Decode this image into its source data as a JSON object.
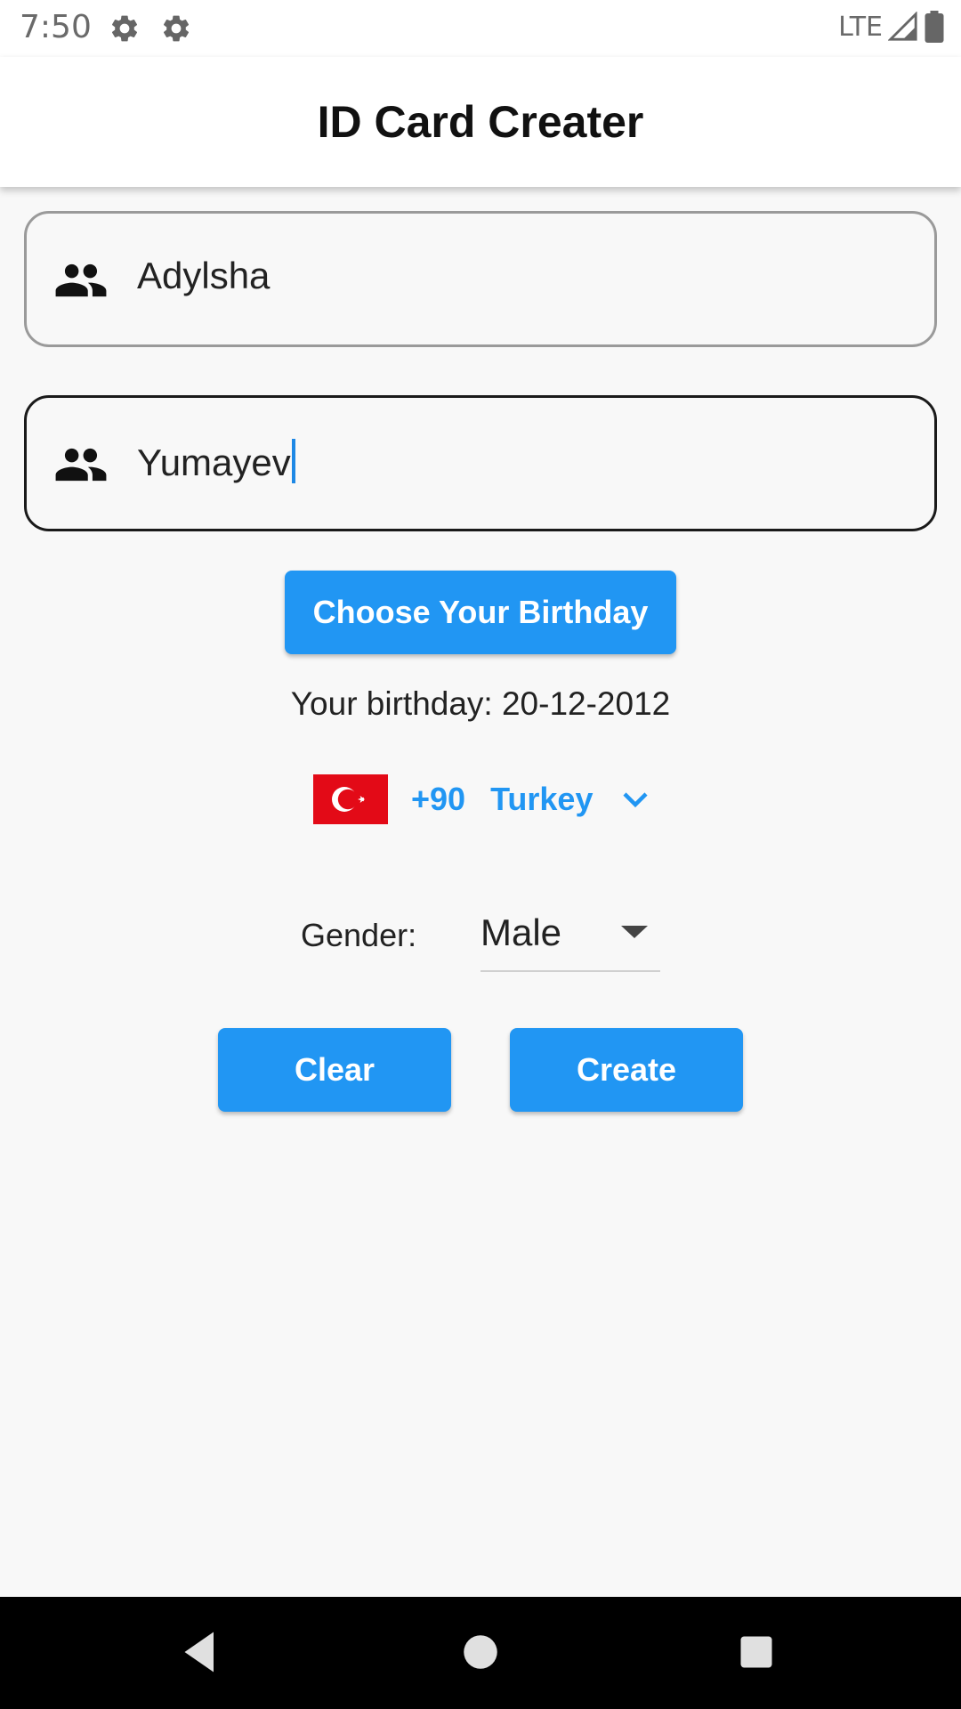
{
  "status_bar": {
    "time": "7:50",
    "icons": [
      "gear-icon",
      "gear-icon"
    ],
    "network": "LTE",
    "right_icons": [
      "signal-icon",
      "battery-icon"
    ]
  },
  "app_bar": {
    "title": "ID Card Creater"
  },
  "form": {
    "first_name": {
      "value": "Adylsha",
      "icon": "people-icon"
    },
    "last_name": {
      "value": "Yumayev",
      "icon": "people-icon",
      "focused": true
    },
    "birthday_button_label": "Choose Your Birthday",
    "birthday_text": "Your birthday: 20-12-2012",
    "country": {
      "code": "+90",
      "name": "Turkey",
      "flag": "turkey-flag-icon"
    },
    "gender": {
      "label": "Gender:",
      "selected": "Male"
    },
    "clear_label": "Clear",
    "create_label": "Create"
  },
  "colors": {
    "accent": "#2196f3",
    "background": "#f8f8f8",
    "flag_red": "#e30a17"
  },
  "nav_bar": {
    "icons": [
      "back-icon",
      "home-icon",
      "recents-icon"
    ]
  }
}
